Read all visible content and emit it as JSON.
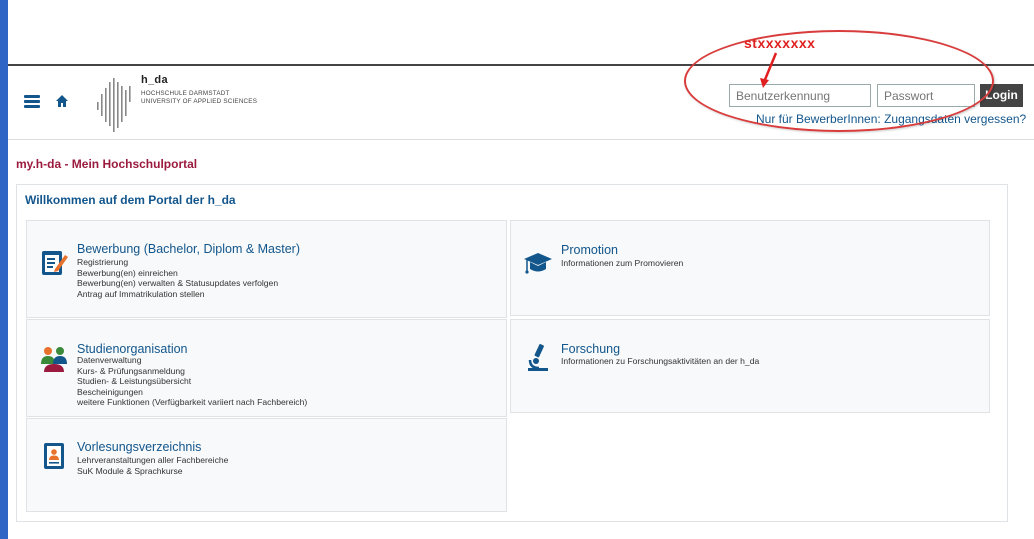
{
  "annotation": {
    "text": "stxxxxxxx"
  },
  "header": {
    "logo_name": "h_da",
    "logo_line1": "HOCHSCHULE DARMSTADT",
    "logo_line2": "UNIVERSITY OF APPLIED SCIENCES",
    "username_placeholder": "Benutzerkennung",
    "password_placeholder": "Passwort",
    "login_label": "Login",
    "forgot_link": "Nur für BewerberInnen: Zugangsdaten vergessen?"
  },
  "breadcrumb": "my.h-da - Mein Hochschulportal",
  "welcome_title": "Willkommen auf dem Portal der h_da",
  "tiles": {
    "bewerbung": {
      "title": "Bewerbung (Bachelor, Diplom & Master)",
      "links": [
        "Registrierung",
        "Bewerbung(en) einreichen",
        "Bewerbung(en) verwalten & Statusupdates verfolgen",
        "Antrag auf Immatrikulation stellen"
      ]
    },
    "promotion": {
      "title": "Promotion",
      "links": [
        "Informationen zum Promovieren"
      ]
    },
    "studienorganisation": {
      "title": "Studienorganisation",
      "links": [
        "Datenverwaltung",
        "Kurs- & Prüfungsanmeldung",
        "Studien- & Leistungsübersicht",
        "Bescheinigungen",
        "weitere Funktionen (Verfügbarkeit variiert nach Fachbereich)"
      ]
    },
    "forschung": {
      "title": "Forschung",
      "links": [
        "Informationen zu Forschungsaktivitäten an der h_da"
      ]
    },
    "vorlesungsverzeichnis": {
      "title": "Vorlesungsverzeichnis",
      "links": [
        "Lehrveranstaltungen aller Fachbereiche",
        "SuK Module & Sprachkurse"
      ]
    }
  },
  "colors": {
    "brand_blue": "#13568c",
    "breadcrumb_red": "#9b1b3e",
    "annotation_red": "#e02020"
  },
  "icons": [
    "menu-icon",
    "home-icon",
    "application-form-icon",
    "graduation-cap-icon",
    "people-icon",
    "microscope-icon",
    "document-person-icon"
  ]
}
